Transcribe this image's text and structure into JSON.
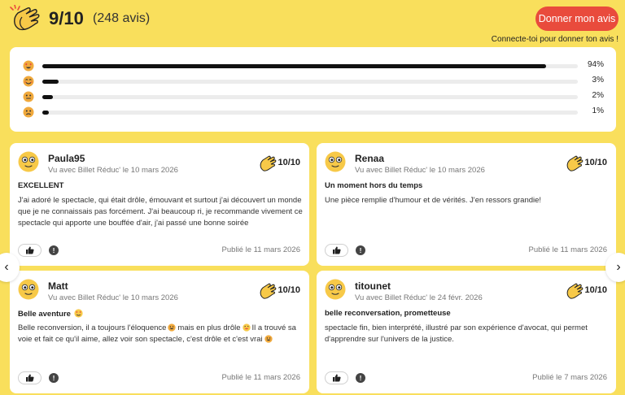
{
  "header": {
    "score": "9/10",
    "count": "(248 avis)",
    "give_label": "Donner mon avis",
    "connect_text": "Connecte-toi pour donner ton avis !",
    "logo_icon": "clapping-hands-icon"
  },
  "distribution": [
    {
      "emoji": "heart-eyes-face-icon",
      "value": 94,
      "label": "94%"
    },
    {
      "emoji": "smiling-face-icon",
      "value": 3,
      "label": "3%"
    },
    {
      "emoji": "neutral-face-icon",
      "value": 2,
      "label": "2%"
    },
    {
      "emoji": "sad-face-icon",
      "value": 1,
      "label": "1%"
    }
  ],
  "reviews": [
    {
      "name": "Paula95",
      "via": "Vu avec Billet Réduc' le 10 mars 2026",
      "rating": "10/10",
      "title": "EXCELLENT",
      "body": "J'ai adoré le spectacle, qui était drôle, émouvant et surtout j'ai découvert un monde que je ne connaissais pas forcément. J'ai beaucoup ri, je recommande vivement ce spectacle qui apporte une bouffée d'air, j'ai passé une bonne soirée",
      "published": "Publié le 11 mars 2026"
    },
    {
      "name": "Renaa",
      "via": "Vu avec Billet Réduc' le 10 mars 2026",
      "rating": "10/10",
      "title": "Un moment hors du temps",
      "body": "Une pièce remplie d'humour et de vérités. J'en ressors grandie!",
      "published": "Publié le 11 mars 2026"
    },
    {
      "name": "Matt",
      "via": "Vu avec Billet Réduc' le 10 mars 2026",
      "rating": "10/10",
      "title": "Belle aventure",
      "body_parts": [
        "Belle reconversion, il a toujours l'éloquence",
        "mais en plus drôle",
        "Il a trouvé sa voie et fait ce qu'il aime, allez voir son spectacle, c'est drôle et c'est vrai"
      ],
      "published": "Publié le 11 mars 2026"
    },
    {
      "name": "titounet",
      "via": "Vu avec Billet Réduc' le 24 févr. 2026",
      "rating": "10/10",
      "title": "belle reconversation, prometteuse",
      "body": "spectacle fin, bien interprété, illustré par son expérience d'avocat, qui permet d'apprendre sur l'univers de la justice.",
      "published": "Publié le 7 mars 2026"
    }
  ],
  "nav": {
    "prev": "‹",
    "next": "›"
  },
  "report_glyph": "!",
  "colors": {
    "background": "#f9df5c",
    "accent": "#e94b3c",
    "bar": "#111111",
    "emoji": "#f7c948"
  }
}
